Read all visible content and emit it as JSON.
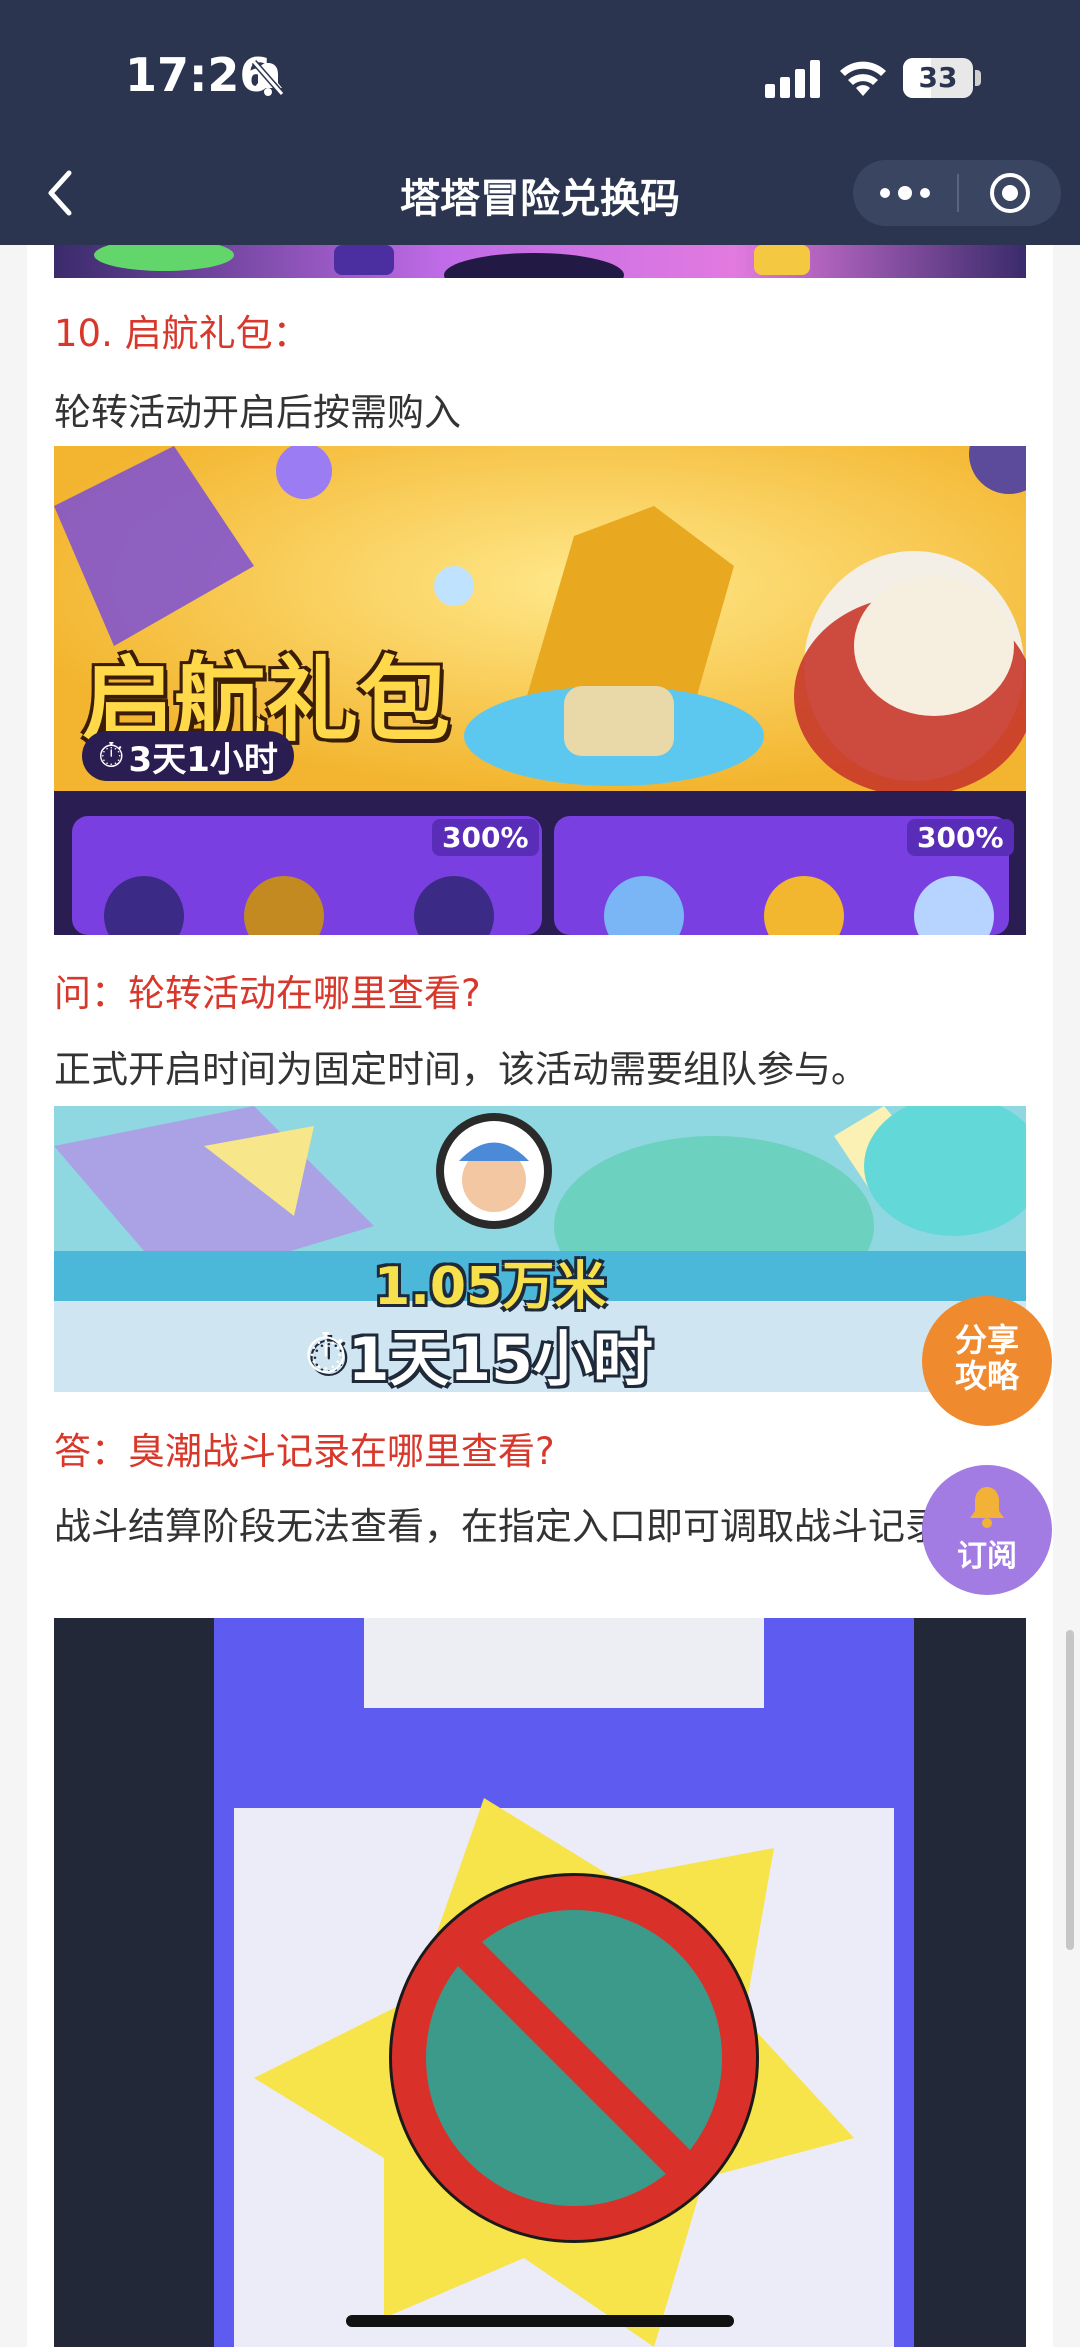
{
  "status_bar": {
    "time": "17:26",
    "battery_level": "33"
  },
  "nav": {
    "title": "塔塔冒险兑换码"
  },
  "article": {
    "sections": [
      {
        "heading": "10. 启航礼包：",
        "text": "轮转活动开启后按需购入"
      },
      {
        "heading": "问：轮转活动在哪里查看?",
        "text": "正式开启时间为固定时间，该活动需要组队参与。"
      },
      {
        "heading": "答：臭潮战斗记录在哪里查看?",
        "text": "战斗结算阶段无法查看，在指定入口即可调取战斗记录。"
      }
    ],
    "images": {
      "pack": {
        "title": "启航礼包",
        "timer": "3天1小时",
        "discount_left": "300%",
        "discount_right": "300%"
      },
      "battle": {
        "distance": "1.05万米",
        "timer": "1天15小时"
      }
    }
  },
  "floating": {
    "share_line1": "分享",
    "share_line2": "攻略",
    "subscribe": "订阅"
  },
  "colors": {
    "nav_bg": "#2b3550",
    "heading_red": "#d8382b",
    "share_orange": "#f08a2f",
    "subscribe_purple": "#a27ce3"
  }
}
